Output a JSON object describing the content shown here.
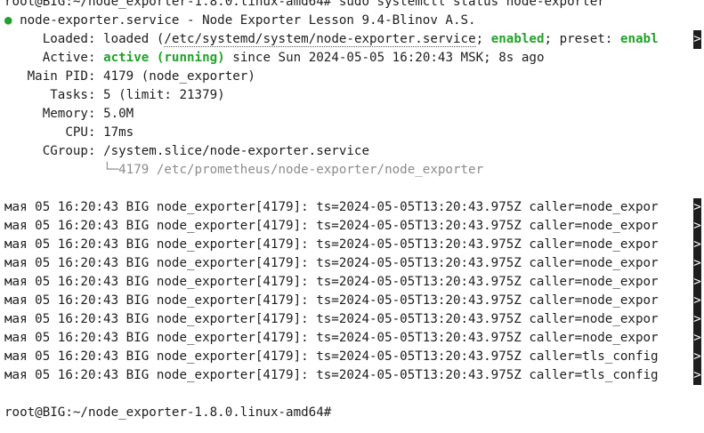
{
  "terminal": {
    "prompt": "root@BIG:~/node_exporter-1.8.0.linux-amd64#",
    "command": " sudo systemctl status node-exporter",
    "service_bullet": "●",
    "service_line": "node-exporter.service - Node Exporter Lesson 9.4-Blinov A.S.",
    "loaded": {
      "label": "Loaded: ",
      "pre": "loaded (",
      "path": "/etc/systemd/system/node-exporter.service",
      "sep": "; ",
      "enabled": "enabled",
      "sep2": "; preset: ",
      "preset": "enabl",
      "trunc_mark": ">"
    },
    "active": {
      "label": "Active: ",
      "state": "active (running)",
      "rest": " since Sun 2024-05-05 16:20:43 MSK; 8s ago"
    },
    "main_pid": {
      "label": "Main PID: ",
      "value": "4179 (node_exporter)"
    },
    "tasks": {
      "label": "Tasks: ",
      "value": "5 (limit: 21379)"
    },
    "memory": {
      "label": "Memory: ",
      "value": "5.0M"
    },
    "cpu": {
      "label": "CPU: ",
      "value": "17ms"
    },
    "cgroup": {
      "label": "CGroup: ",
      "value": "/system.slice/node-exporter.service"
    },
    "cgroup_child": "└─4179 /etc/prometheus/node-exporter/node_exporter",
    "log_lines": [
      "мая 05 16:20:43 BIG node_exporter[4179]: ts=2024-05-05T13:20:43.975Z caller=node_expor",
      "мая 05 16:20:43 BIG node_exporter[4179]: ts=2024-05-05T13:20:43.975Z caller=node_expor",
      "мая 05 16:20:43 BIG node_exporter[4179]: ts=2024-05-05T13:20:43.975Z caller=node_expor",
      "мая 05 16:20:43 BIG node_exporter[4179]: ts=2024-05-05T13:20:43.975Z caller=node_expor",
      "мая 05 16:20:43 BIG node_exporter[4179]: ts=2024-05-05T13:20:43.975Z caller=node_expor",
      "мая 05 16:20:43 BIG node_exporter[4179]: ts=2024-05-05T13:20:43.975Z caller=node_expor",
      "мая 05 16:20:43 BIG node_exporter[4179]: ts=2024-05-05T13:20:43.975Z caller=node_expor",
      "мая 05 16:20:43 BIG node_exporter[4179]: ts=2024-05-05T13:20:43.975Z caller=node_expor",
      "мая 05 16:20:43 BIG node_exporter[4179]: ts=2024-05-05T13:20:43.975Z caller=tls_config",
      "мая 05 16:20:43 BIG node_exporter[4179]: ts=2024-05-05T13:20:43.975Z caller=tls_config"
    ],
    "trunc_mark": ">",
    "final_prompt": "root@BIG:~/node_exporter-1.8.0.linux-amd64#"
  },
  "colors": {
    "background": "#ffffff",
    "text": "#1e1e1e",
    "green": "#22a22b",
    "gray": "#8c8c8c"
  }
}
